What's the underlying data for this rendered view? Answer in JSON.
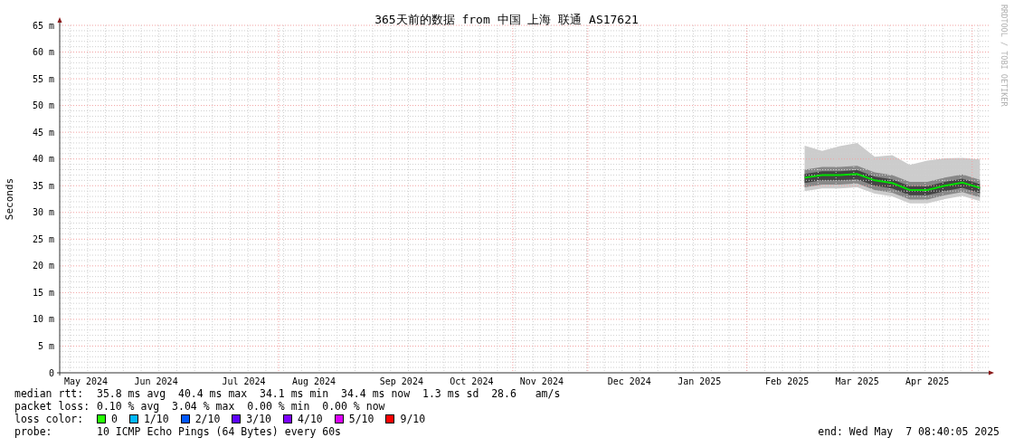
{
  "title": "365天前的数据 from 中国 上海 联通 AS17621",
  "credit": "RRDTOOL / TOBI OETIKER",
  "chart_data": {
    "type": "line",
    "grid": true,
    "ylabel": "Seconds",
    "ylim": [
      0,
      65
    ],
    "yticks": [
      {
        "value": 0,
        "label": "0"
      },
      {
        "value": 5,
        "label": "5 m"
      },
      {
        "value": 10,
        "label": "10 m"
      },
      {
        "value": 15,
        "label": "15 m"
      },
      {
        "value": 20,
        "label": "20 m"
      },
      {
        "value": 25,
        "label": "25 m"
      },
      {
        "value": 30,
        "label": "30 m"
      },
      {
        "value": 35,
        "label": "35 m"
      },
      {
        "value": 40,
        "label": "40 m"
      },
      {
        "value": 45,
        "label": "45 m"
      },
      {
        "value": 50,
        "label": "50 m"
      },
      {
        "value": 55,
        "label": "55 m"
      },
      {
        "value": 60,
        "label": "60 m"
      },
      {
        "value": 65,
        "label": "65 m"
      }
    ],
    "categories": [
      null,
      "May 2024",
      null,
      null,
      null,
      "Jun 2024",
      null,
      null,
      null,
      null,
      "Jul 2024",
      null,
      null,
      null,
      "Aug 2024",
      null,
      null,
      null,
      null,
      "Sep 2024",
      null,
      null,
      null,
      "Oct 2024",
      null,
      null,
      null,
      "Nov 2024",
      null,
      null,
      null,
      null,
      "Dec 2024",
      null,
      null,
      null,
      "Jan 2025",
      null,
      null,
      null,
      null,
      "Feb 2025",
      null,
      null,
      null,
      "Mar 2025",
      null,
      null,
      null,
      "Apr 2025",
      null,
      null,
      null
    ],
    "series": [
      {
        "color": "#00dd00",
        "values": [
          null,
          null,
          null,
          null,
          null,
          null,
          null,
          null,
          null,
          null,
          null,
          null,
          null,
          null,
          null,
          null,
          null,
          null,
          null,
          null,
          null,
          null,
          null,
          null,
          null,
          null,
          null,
          null,
          null,
          null,
          null,
          null,
          null,
          null,
          null,
          null,
          null,
          null,
          null,
          null,
          null,
          null,
          36.5,
          37,
          37,
          37.2,
          36,
          35.5,
          34.2,
          34.2,
          35,
          35.6,
          34.6
        ]
      }
    ]
  },
  "legend": {
    "median_rtt": {
      "label": "median rtt:",
      "value": "35.8 ms avg  40.4 ms max  34.1 ms min  34.4 ms now  1.3 ms sd  28.6   am/s"
    },
    "packet_loss": {
      "label": "packet loss:",
      "value": "0.10 % avg  3.04 % max  0.00 % min  0.00 % now"
    },
    "loss_color": {
      "label": "loss color:",
      "items": [
        {
          "label": "0",
          "color": "#26ff00"
        },
        {
          "label": "1/10",
          "color": "#00b8ff"
        },
        {
          "label": "2/10",
          "color": "#0059ff"
        },
        {
          "label": "3/10",
          "color": "#5e00ff"
        },
        {
          "label": "4/10",
          "color": "#7e00ff"
        },
        {
          "label": "5/10",
          "color": "#dd00ff"
        },
        {
          "label": "9/10",
          "color": "#ff0000"
        }
      ]
    },
    "probe": {
      "label": "probe:",
      "value": "10 ICMP Echo Pings (64 Bytes) every 60s"
    },
    "end": "end: Wed May  7 08:40:05 2025"
  }
}
